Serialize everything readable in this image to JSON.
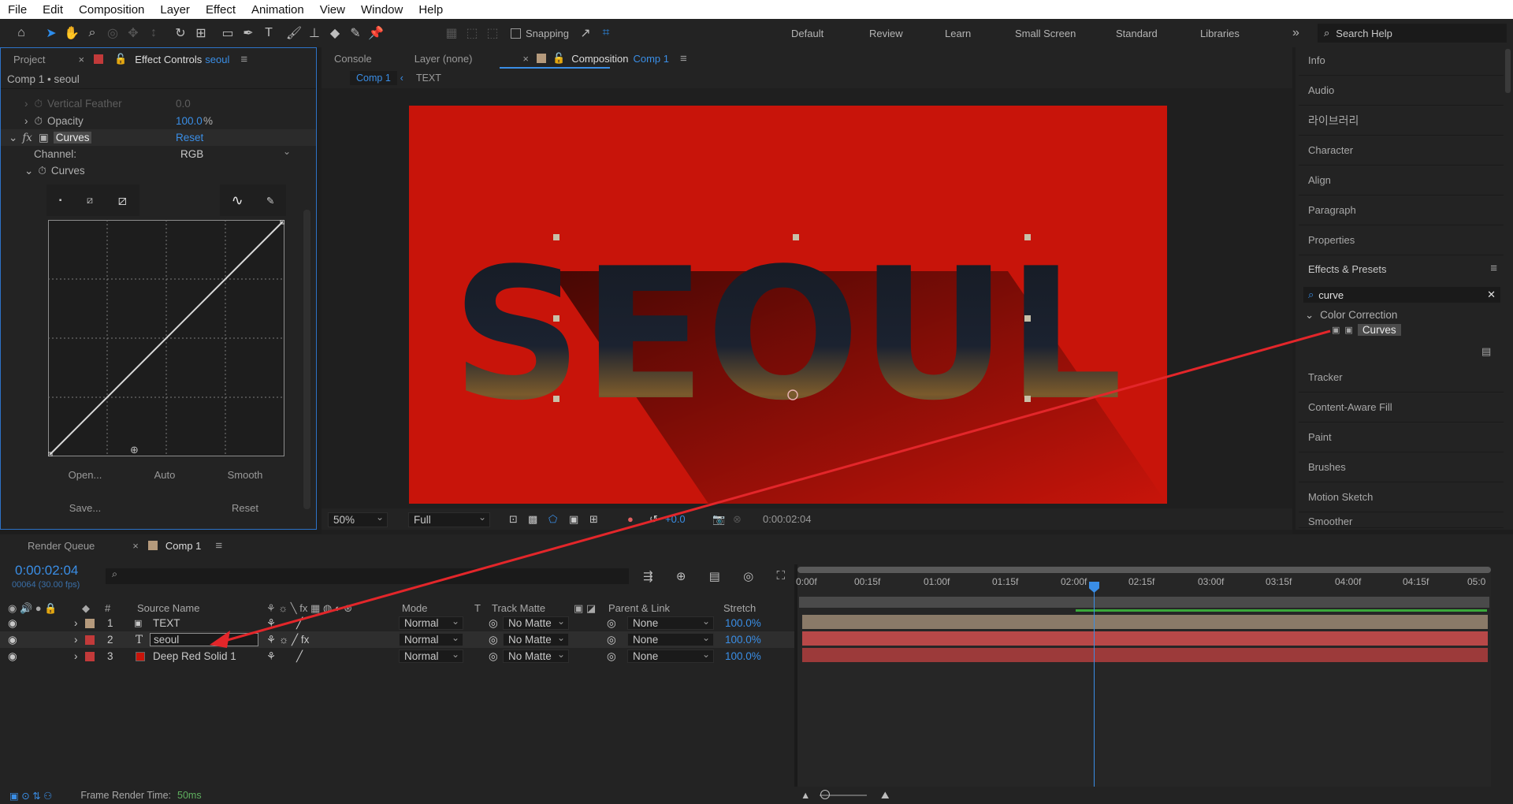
{
  "menu": [
    "File",
    "Edit",
    "Composition",
    "Layer",
    "Effect",
    "Animation",
    "View",
    "Window",
    "Help"
  ],
  "toolbar": {
    "snapping_label": "Snapping",
    "workspaces": [
      "Default",
      "Review",
      "Learn",
      "Small Screen",
      "Standard",
      "Libraries"
    ],
    "search_placeholder": "Search Help"
  },
  "left_panel": {
    "tab_project": "Project",
    "tab_effect_controls": "Effect Controls",
    "tab_effect_layer": "seoul",
    "breadcrumb": "Comp 1 • seoul",
    "rows": {
      "vertical_feather": {
        "label": "Vertical Feather",
        "value": "0.0"
      },
      "opacity": {
        "label": "Opacity",
        "value": "100.0",
        "unit": "%"
      },
      "curves": {
        "label": "Curves",
        "reset": "Reset"
      },
      "channel": {
        "label": "Channel:",
        "value": "RGB"
      },
      "curves_sub": {
        "label": "Curves"
      }
    },
    "buttons": {
      "open": "Open...",
      "auto": "Auto",
      "smooth": "Smooth",
      "save": "Save...",
      "reset": "Reset"
    }
  },
  "comp_panel": {
    "tab_console": "Console",
    "tab_layer": "Layer (none)",
    "tab_composition": "Composition",
    "tab_comp_name": "Comp 1",
    "sub_active": "Comp 1",
    "sub_other": "TEXT",
    "canvas_text": "SEOUL",
    "footer": {
      "zoom": "50%",
      "resolution": "Full",
      "exposure": "+0.0",
      "timecode": "0:00:02:04"
    },
    "colors": {
      "background": "#c8140a",
      "text": "#161b24"
    }
  },
  "right_panel": {
    "items_top": [
      "Info",
      "Audio",
      "라이브러리",
      "Character",
      "Align",
      "Paragraph",
      "Properties"
    ],
    "effects_title": "Effects & Presets",
    "search_value": "curve",
    "category": "Color Correction",
    "result": "Curves",
    "items_bottom": [
      "Tracker",
      "Content-Aware Fill",
      "Paint",
      "Brushes",
      "Motion Sketch",
      "Smoother"
    ]
  },
  "timeline": {
    "tab_render": "Render Queue",
    "tab_comp": "Comp 1",
    "timecode": "0:00:02:04",
    "frames": "00064 (30.00 fps)",
    "headers": {
      "num": "#",
      "source": "Source Name",
      "mode": "Mode",
      "t": "T",
      "track_matte": "Track Matte",
      "parent": "Parent & Link",
      "stretch": "Stretch"
    },
    "ruler": [
      "0:00f",
      "00:15f",
      "01:00f",
      "01:15f",
      "02:00f",
      "02:15f",
      "03:00f",
      "03:15f",
      "04:00f",
      "04:15f",
      "05:0"
    ],
    "layers": [
      {
        "num": "1",
        "name": "TEXT",
        "mode": "Normal",
        "matte": "No Matte",
        "parent": "None",
        "stretch": "100.0%",
        "color": "#b59a7c"
      },
      {
        "num": "2",
        "name": "seoul",
        "mode": "Normal",
        "matte": "No Matte",
        "parent": "None",
        "stretch": "100.0%",
        "color": "#c23a3a"
      },
      {
        "num": "3",
        "name": "Deep Red Solid 1",
        "mode": "Normal",
        "matte": "No Matte",
        "parent": "None",
        "stretch": "100.0%",
        "color": "#c23a3a"
      }
    ],
    "status_label": "Frame Render Time:",
    "status_value": "50ms"
  }
}
